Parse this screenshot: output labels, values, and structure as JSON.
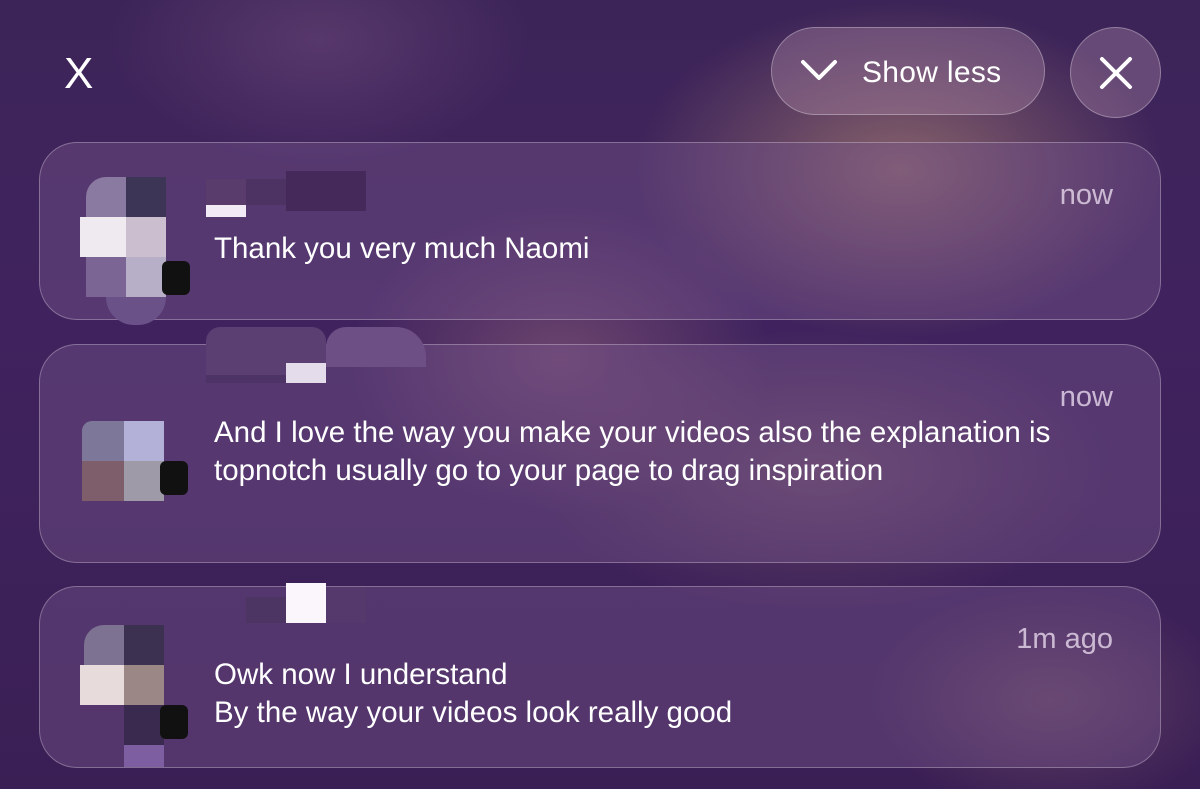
{
  "header": {
    "dismiss_label": "X",
    "show_less_label": "Show less",
    "show_less_icon": "chevron-down-icon",
    "clear_icon": "close-icon"
  },
  "notifications": [
    {
      "time": "now",
      "message": "Thank you very much Naomi"
    },
    {
      "time": "now",
      "message": "And I love the way you make your videos also the explanation is topnotch usually go to your page to drag inspiration"
    },
    {
      "time": "1m ago",
      "message": "Owk now I understand\nBy the way your videos look really good"
    }
  ],
  "colors": {
    "background": "#3e235b",
    "card_fill": "rgba(120,85,140,0.42)",
    "timestamp": "#e8d8ef"
  }
}
